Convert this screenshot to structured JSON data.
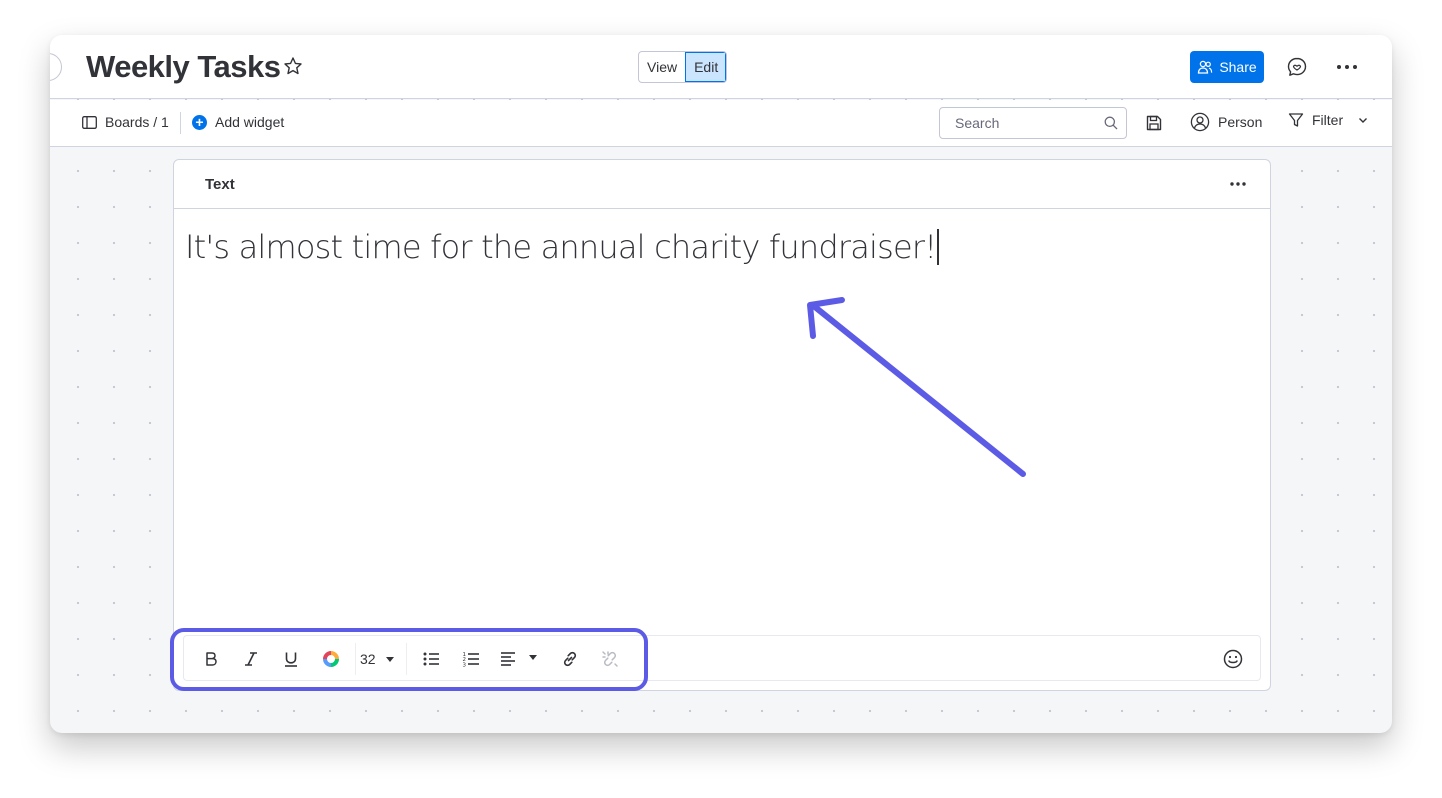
{
  "header": {
    "title": "Weekly Tasks",
    "view_label": "View",
    "edit_label": "Edit",
    "share_label": "Share"
  },
  "toolbar": {
    "boards_crumb": "Boards / 1",
    "add_widget_label": "Add widget",
    "search_placeholder": "Search",
    "person_label": "Person",
    "filter_label": "Filter"
  },
  "widget": {
    "title": "Text",
    "content": "It's almost time for the annual charity fundraiser!",
    "font_size_value": "32"
  },
  "colors": {
    "accent": "#0073ea",
    "annotation": "#5c5be5",
    "edit_active_bg": "#cce5ff"
  },
  "icons": [
    "collapse-icon",
    "star-icon",
    "share-people-icon",
    "updates-icon",
    "more-icon",
    "board-icon",
    "plus-circle-icon",
    "search-icon",
    "save-icon",
    "person-icon",
    "filter-icon",
    "chevron-down-icon",
    "bold-icon",
    "italic-icon",
    "underline-icon",
    "color-wheel-icon",
    "bullet-list-icon",
    "numbered-list-icon",
    "align-icon",
    "link-icon",
    "unlink-icon",
    "emoji-icon"
  ]
}
